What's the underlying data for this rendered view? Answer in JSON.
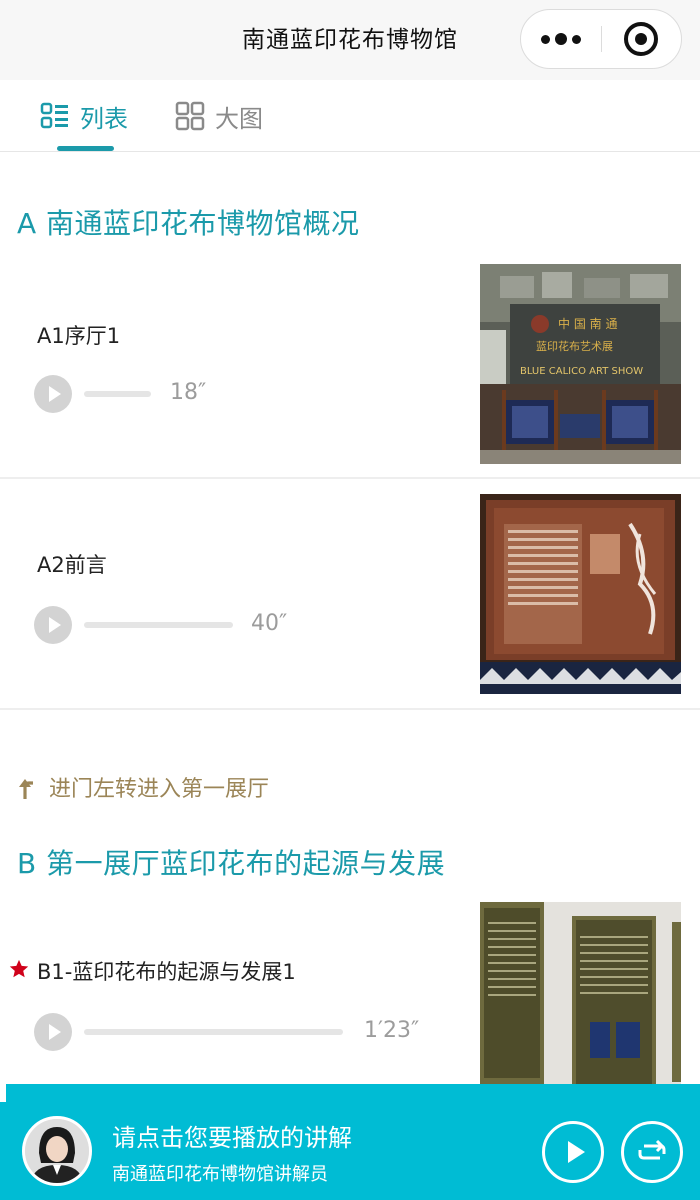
{
  "app": {
    "title": "南通蓝印花布博物馆"
  },
  "capsule": {
    "more_icon": "more-dots-icon",
    "close_icon": "target-close-icon"
  },
  "tabs": [
    {
      "label": "列表",
      "icon": "list-icon",
      "active": true
    },
    {
      "label": "大图",
      "icon": "grid-icon",
      "active": false
    }
  ],
  "sections": [
    {
      "title": "A 南通蓝印花布博物馆概况",
      "items": [
        {
          "name": "A1序厅1",
          "duration": "18″",
          "progress": 0
        },
        {
          "name": "A2前言",
          "duration": "40″",
          "progress": 0
        }
      ]
    },
    {
      "guide": "进门左转进入第一展厅",
      "title": "B 第一展厅蓝印花布的起源与发展",
      "items": [
        {
          "name": "B1-蓝印花布的起源与发展1",
          "duration": "1′23″",
          "progress": 0,
          "starred": true
        }
      ]
    }
  ],
  "player": {
    "title": "请点击您要播放的讲解",
    "subtitle": "南通蓝印花布博物馆讲解员",
    "play_icon": "play-icon",
    "loop_icon": "loop-icon"
  },
  "colors": {
    "accent": "#1b9aaa",
    "player_bg": "#00bcd4",
    "guide": "#9b8557",
    "star": "#d0021b"
  }
}
